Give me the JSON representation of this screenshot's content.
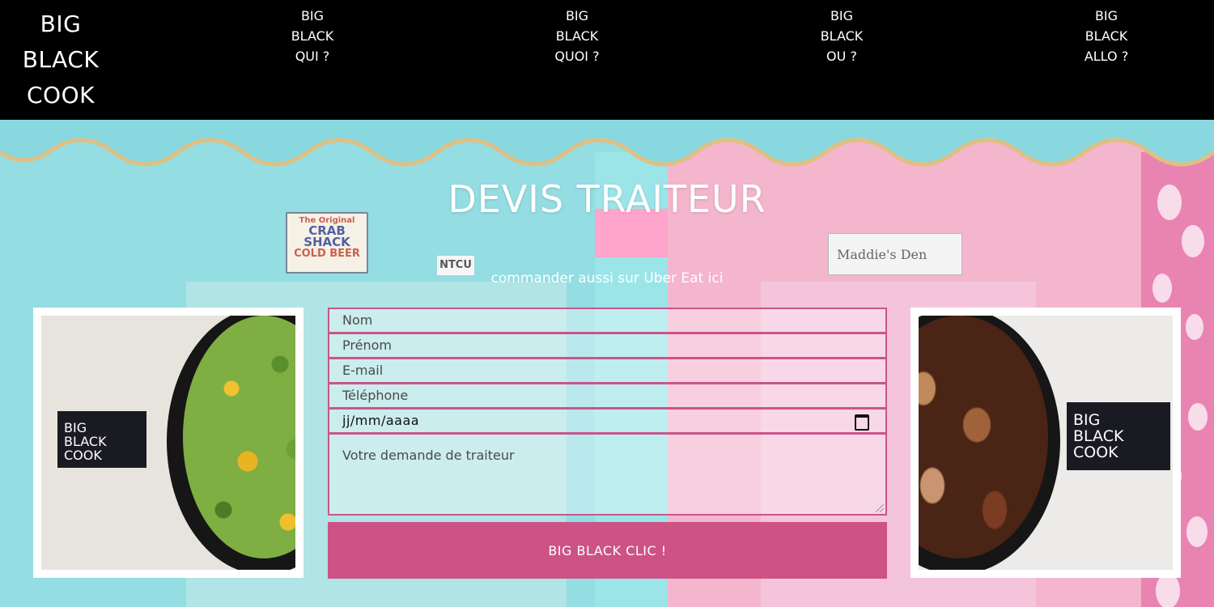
{
  "header": {
    "logo_lines": [
      "BIG",
      "BLACK",
      "COOK"
    ],
    "nav": [
      {
        "lines": [
          "BIG",
          "BLACK",
          "QUI ?"
        ]
      },
      {
        "lines": [
          "BIG",
          "BLACK",
          "QUOI ?"
        ]
      },
      {
        "lines": [
          "BIG",
          "BLACK",
          "OU ?"
        ]
      },
      {
        "lines": [
          "BIG",
          "BLACK",
          "ALLO ?"
        ]
      }
    ]
  },
  "hero": {
    "title": "DEVIS TRAITEUR",
    "subtitle": "commander aussi sur Uber Eat ici",
    "signs": {
      "crab": [
        "The Original",
        "CRAB",
        "SHACK",
        "COLD BEER"
      ],
      "ntcu": "NTCU",
      "maddie": "Maddie's Den"
    }
  },
  "cards": {
    "left_label": [
      "BIG",
      "BLACK",
      "COOK"
    ],
    "right_label": [
      "BIG",
      "BLACK",
      "COOK"
    ]
  },
  "form": {
    "nom_placeholder": "Nom",
    "prenom_placeholder": "Prénom",
    "email_placeholder": "E-mail",
    "telephone_placeholder": "Téléphone",
    "date_value": "jj/mm/aaaa",
    "demande_placeholder": "Votre demande de traiteur",
    "submit_label": "BIG BLACK CLIC !"
  },
  "colors": {
    "header_bg": "#000000",
    "accent": "#cd5286",
    "field_border": "#c9558a"
  }
}
